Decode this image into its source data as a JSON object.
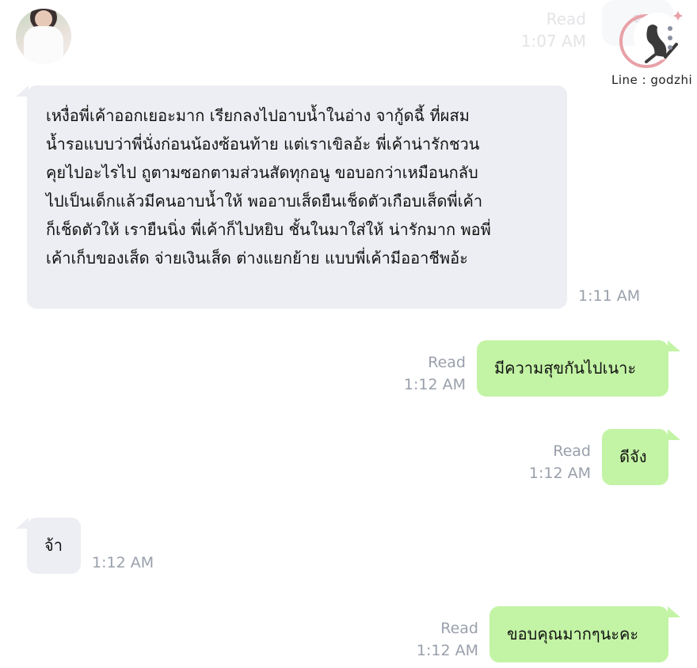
{
  "header_remnant": {
    "read": "Read",
    "time": "1:07 AM",
    "text": "รีวิว"
  },
  "logo": {
    "text": "Line : godzhi"
  },
  "messages": [
    {
      "direction": "incoming",
      "lines": [
        "เหงื่อพี่เค้าออกเยอะมาก เรียกลงไปอาบน้ำในอ่าง จากู้ดฉี้ ที่ผสม",
        "น้ำรอแบบว่าพี่นั่งก่อนน้องซ้อนท้าย แต่เราเขิลอ้ะ พี่เค้าน่ารักชวน",
        "คุยไปอะไรไป ถูตามซอกตามส่วนสัดทุกอนู ขอบอกว่าเหมือนกลับ",
        "ไปเป็นเด็กแล้วมีคนอาบน้ำให้ พออาบเส็ดยืนเช็ดตัวเกือบเส็ดพี่เค้า",
        "ก็เช็ดตัวให้ เรายืนนิ่ง พี่เค้าก็ไปหยิบ ชั้นในมาใส่ให้ น่ารักมาก พอพี่",
        "เค้าเก็บของเส็ด จ่ายเงินเส็ด ต่างแยกย้าย แบบพี่เค้ามีออาชีพอ้ะ"
      ],
      "time": "1:11 AM"
    },
    {
      "direction": "outgoing",
      "text": "มีความสุขกันไปเนาะ",
      "read": "Read",
      "time": "1:12 AM"
    },
    {
      "direction": "outgoing",
      "text": "ดีจัง",
      "read": "Read",
      "time": "1:12 AM"
    },
    {
      "direction": "incoming",
      "text": "จ้า",
      "time": "1:12 AM"
    },
    {
      "direction": "outgoing",
      "text": "ขอบคุณมากๆนะคะ",
      "read": "Read",
      "time": "1:12 AM"
    }
  ],
  "colors": {
    "incoming_bubble": "#edeef3",
    "outgoing_bubble": "#c3f4a5",
    "meta": "#9aa0ab",
    "logo_accent": "#e8a1a7"
  }
}
